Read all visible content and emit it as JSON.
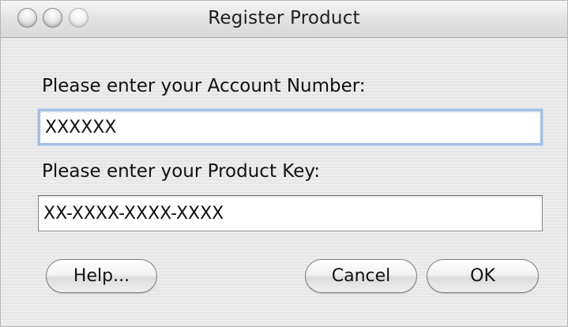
{
  "window": {
    "title": "Register Product"
  },
  "form": {
    "account_label": "Please enter your Account Number:",
    "account_value": "XXXXXX",
    "key_label": "Please enter your Product Key:",
    "key_value": "XX-XXXX-XXXX-XXXX"
  },
  "buttons": {
    "help": "Help...",
    "cancel": "Cancel",
    "ok": "OK"
  },
  "colors": {
    "focus_ring": "#a4bfe2",
    "window_background": "#ececec"
  },
  "icons": {
    "close": "close-icon",
    "minimize": "minimize-icon",
    "zoom": "zoom-icon"
  }
}
